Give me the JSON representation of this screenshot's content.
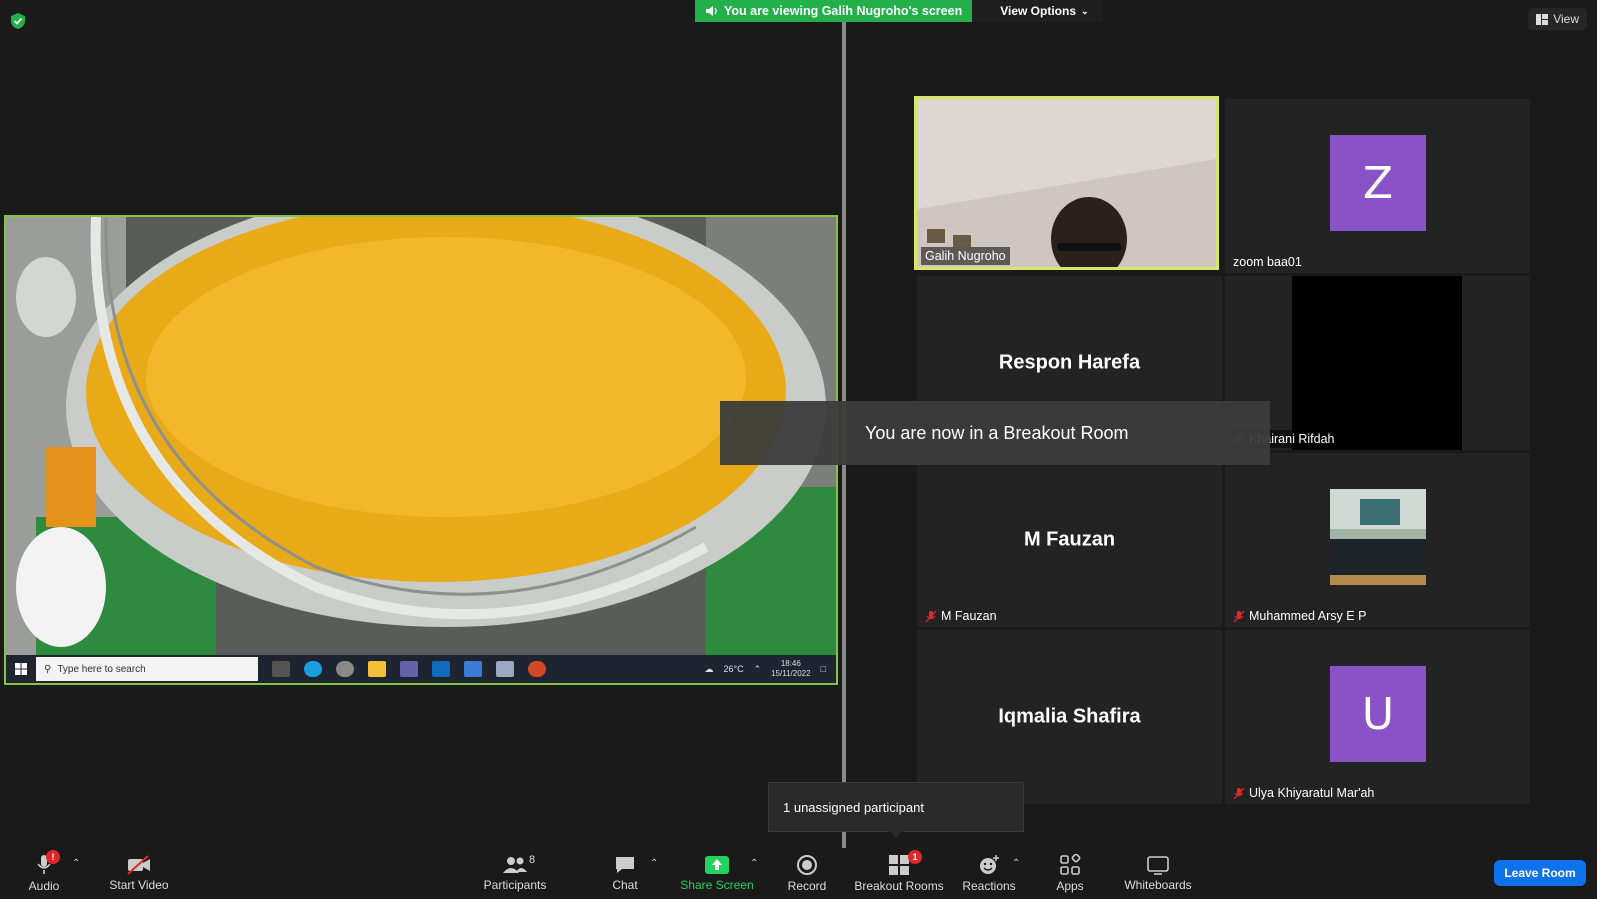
{
  "banner": {
    "viewing_text": "You are viewing Galih Nugroho's screen",
    "view_options": "View Options"
  },
  "view_button": "View",
  "shared_screen": {
    "taskbar": {
      "search_placeholder": "Type here to search",
      "weather": "26°C",
      "time": "18:46",
      "date": "15/11/2022"
    }
  },
  "gallery": [
    {
      "name": "Galih Nugroho",
      "type": "video",
      "active": true,
      "muted": false
    },
    {
      "name": "zoom baa01",
      "type": "avatar",
      "avatar_letter": "Z",
      "muted": false
    },
    {
      "name": "Respon Harefa",
      "type": "name_only",
      "muted": false
    },
    {
      "name": "Khairani Rifdah",
      "type": "black",
      "muted": true
    },
    {
      "name": "M Fauzan",
      "display_name": "M Fauzan",
      "type": "name_only",
      "muted": true
    },
    {
      "name": "Muhammed Arsy E P",
      "type": "photo",
      "muted": true
    },
    {
      "name": "Iqmalia Shafira",
      "type": "name_only",
      "muted": false
    },
    {
      "name": "Ulya Khiyaratul Mar'ah",
      "type": "avatar",
      "avatar_letter": "U",
      "muted": true
    }
  ],
  "toast": "You are now in a Breakout Room",
  "unassigned_tooltip": "1 unassigned participant",
  "toolbar": {
    "audio": "Audio",
    "start_video": "Start Video",
    "participants": "Participants",
    "participants_count": "8",
    "chat": "Chat",
    "share_screen": "Share Screen",
    "record": "Record",
    "breakout_rooms": "Breakout Rooms",
    "breakout_badge": "1",
    "reactions": "Reactions",
    "apps": "Apps",
    "whiteboards": "Whiteboards",
    "leave_room": "Leave Room"
  },
  "colors": {
    "accent_green": "#23b04b",
    "active_speaker_border": "#d7e56a",
    "share_border": "#86c440",
    "avatar_purple": "#8a52c7",
    "leave_blue": "#0e72ed",
    "mute_red": "#e02828"
  }
}
